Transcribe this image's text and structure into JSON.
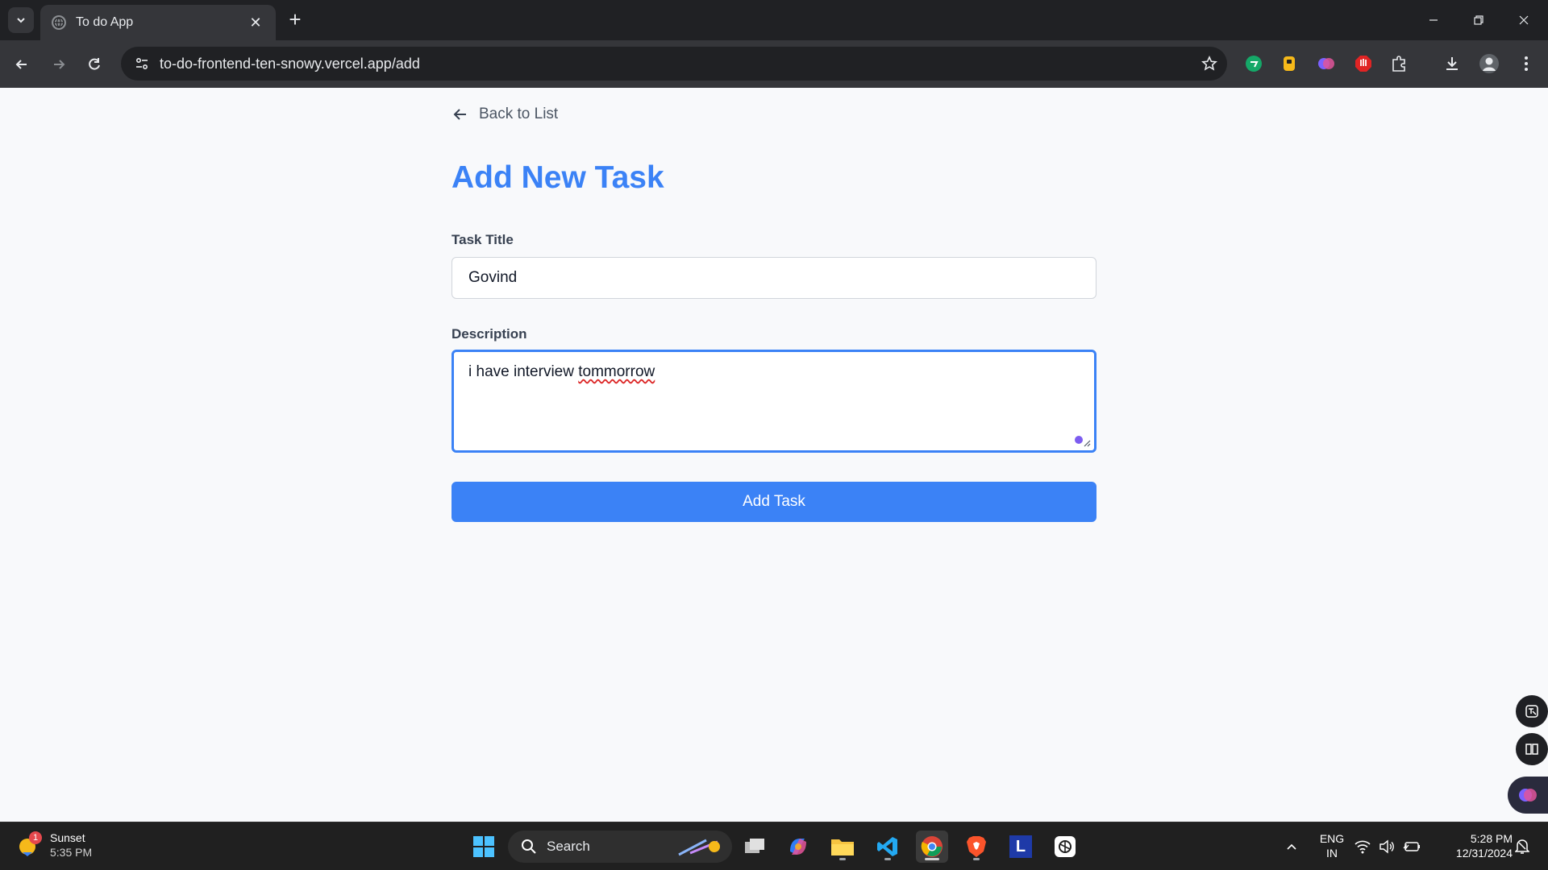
{
  "browser": {
    "tab_title": "To do App",
    "url": "to-do-frontend-ten-snowy.vercel.app/add"
  },
  "page": {
    "back_link": "Back to List",
    "heading": "Add New Task",
    "title_label": "Task Title",
    "title_value": "Govind",
    "description_label": "Description",
    "description_value_prefix": "i have interview ",
    "description_value_misspelled": "tommorrow",
    "submit_label": "Add Task"
  },
  "taskbar": {
    "weather_label": "Sunset",
    "weather_time": "5:35 PM",
    "weather_badge": "1",
    "search_label": "Search",
    "language_line1": "ENG",
    "language_line2": "IN",
    "clock_time": "5:28 PM",
    "clock_date": "12/31/2024"
  },
  "colors": {
    "accent": "#3b82f6",
    "heading": "#3b82f6"
  }
}
